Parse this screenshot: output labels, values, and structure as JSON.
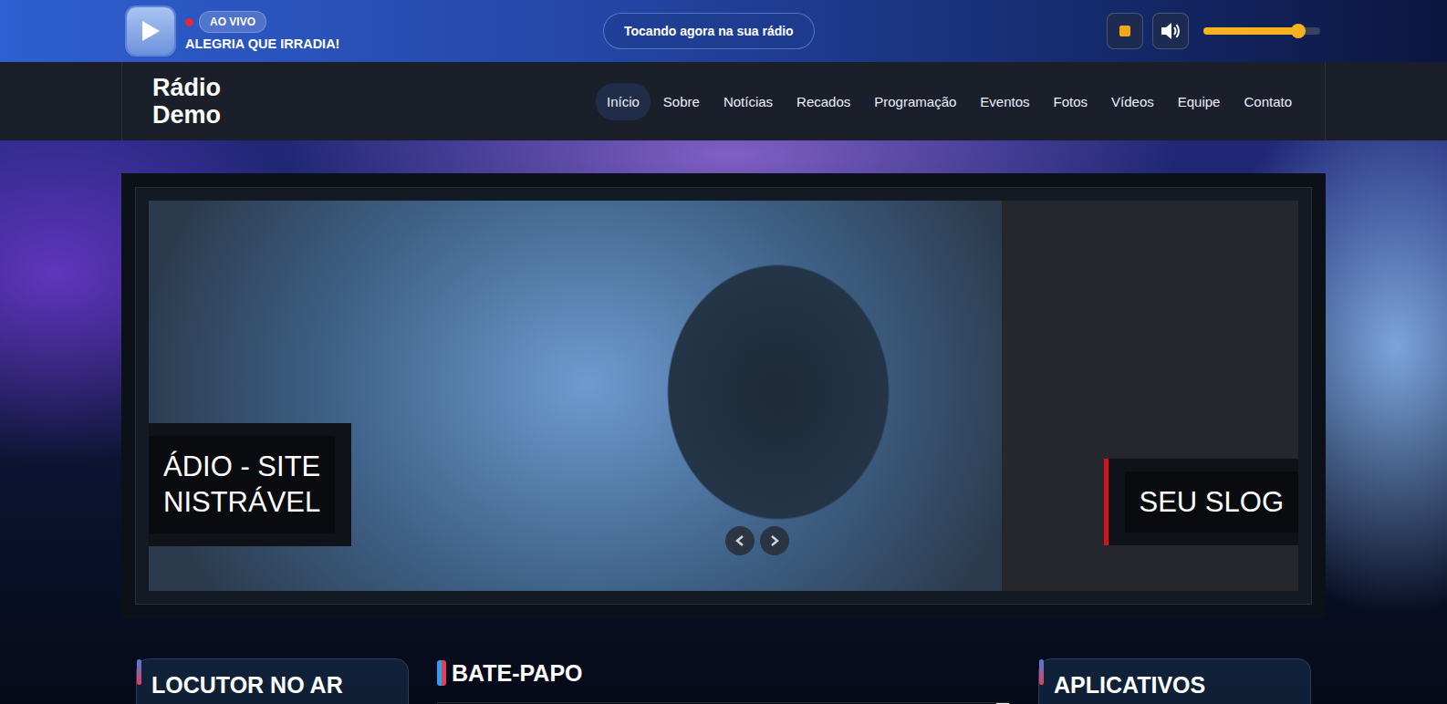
{
  "player": {
    "live_badge": "AO VIVO",
    "slogan": "ALEGRIA QUE IRRADIA!",
    "now_playing": "Tocando agora na sua rádio",
    "volume": {
      "level": 0.81
    }
  },
  "nav": {
    "logo": [
      "Rádio",
      "Demo"
    ],
    "items": [
      {
        "label": "Início",
        "selected": true
      },
      {
        "label": "Sobre",
        "selected": false
      },
      {
        "label": "Notícias",
        "selected": false
      },
      {
        "label": "Recados",
        "selected": false
      },
      {
        "label": "Programação",
        "selected": false
      },
      {
        "label": "Eventos",
        "selected": false
      },
      {
        "label": "Fotos",
        "selected": false
      },
      {
        "label": "Vídeos",
        "selected": false
      },
      {
        "label": "Equipe",
        "selected": false
      },
      {
        "label": "Contato",
        "selected": false
      }
    ]
  },
  "slider": {
    "captions": [
      {
        "lines": [
          "ÁDIO - SITE",
          "NISTRÁVEL"
        ]
      },
      {
        "lines": [
          "SEU SLOG"
        ]
      }
    ]
  },
  "sections": [
    {
      "title": "LOCUTOR NO AR"
    },
    {
      "title": "BATE-PAPO"
    },
    {
      "title": "APLICATIVOS"
    }
  ]
}
